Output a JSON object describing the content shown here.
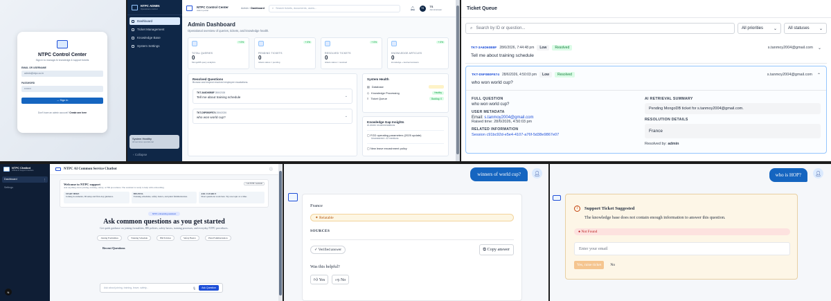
{
  "login": {
    "title": "NTPC Control Center",
    "subtitle": "Sign in to manage AI knowledge & support tickets",
    "email_label": "EMAIL OR USERNAME",
    "email_value": "admin@ntpc.co.in",
    "password_label": "PASSWORD",
    "password_value": "••••••••",
    "signin_label": "Sign In",
    "footer_text": "Don't have an admin account?",
    "footer_link": "Create one here"
  },
  "admin": {
    "brand_title": "NTPC ADMIN",
    "brand_sub": "Operations control",
    "nav": [
      {
        "label": "Dashboard"
      },
      {
        "label": "Ticket Management"
      },
      {
        "label": "Knowledge Base"
      },
      {
        "label": "System Settings"
      }
    ],
    "health_title": "System Healthy",
    "health_sub": "All services operational",
    "collapse_label": "Collapse",
    "app_title": "NTPC Control Center",
    "app_sub": "Admin portal",
    "crumb_root": "Admin",
    "crumb_page": "Dashboard",
    "search_placeholder": "Search tickets, documents, users...",
    "user_initials": "TS",
    "user_name": "TS",
    "user_role": "Administrator",
    "page_title": "Admin Dashboard",
    "page_sub": "Operational overview of queries, tickets, and knowledge health.",
    "stats": [
      {
        "label": "TOTAL QUERIES",
        "value": "0",
        "desc": "MongoDB query analytics",
        "pct": "+ 0%"
      },
      {
        "label": "PENDING TICKETS",
        "value": "0",
        "desc": "tickets status = pending",
        "pct": "+ 0%"
      },
      {
        "label": "RESOLVED TICKETS",
        "value": "0",
        "desc": "tickets status = resolved",
        "pct": "+ 0%"
      },
      {
        "label": "KNOWLEDGE ARTICLES",
        "value": "0",
        "desc": "knowledge + learned answers",
        "pct": "+ 0%"
      }
    ],
    "resolved_title": "Resolved Questions",
    "resolved_sub": "Browse and inspect resolved employee escalations.",
    "resolved_items": [
      {
        "id": "TKT-3A6D60B8F",
        "date": "28/6/2026",
        "question": "Tell me about training schedule"
      },
      {
        "id": "TKT-D5F0B0FE74",
        "date": "28/6/2026",
        "question": "who won world cup?"
      }
    ],
    "health_card_title": "System Health",
    "health_rows": [
      {
        "label": "Database",
        "badge": "",
        "color": "#f59e0b",
        "bg": "#fef3c7"
      },
      {
        "label": "Knowledge Processing",
        "badge": "Healthy",
        "color": "#16a34a",
        "bg": "#dcfce7"
      },
      {
        "label": "Ticket Queue",
        "badge": "Backlog: 0",
        "color": "#16a34a",
        "bg": "#dcfce7"
      }
    ],
    "gap_title": "Knowledge Gap Insights",
    "gap_sub": "AI-driven recommendations",
    "gap_items": [
      {
        "title": "FGD operating parameters (2025 update)",
        "sub": "Unanswered • 42 mentions"
      },
      {
        "title": "New leave encashment policy",
        "sub": ""
      }
    ]
  },
  "queue": {
    "title": "Ticket Queue",
    "search_placeholder": "Search by ID or question...",
    "priority_label": "All priorities",
    "status_label": "All statuses",
    "tickets": [
      {
        "id": "TKT-3A6D60B8F",
        "datetime": "28/6/2026, 7:44:48 pm",
        "priority": "Low",
        "status": "Resolved",
        "email": "s.tanmoy2004@gmail.com",
        "question": "Tell me about training schedule"
      },
      {
        "id": "TKT-D5F0B0FE74",
        "datetime": "28/6/2026, 4:50:03 pm",
        "priority": "Low",
        "status": "Resolved",
        "email": "s.tanmoy2004@gmail.com",
        "question": "who won world cup?"
      }
    ],
    "detail": {
      "full_question_label": "FULL QUESTION",
      "full_question": "who won world cup?",
      "metadata_label": "USER METADATA",
      "email_prefix": "Email:",
      "email": "s.tanmoy2004@gmail.com",
      "raised": "Raised time: 28/6/2026, 4:50:03 pm",
      "related_label": "RELATED INFORMATION",
      "session": "Session c91bc92d-e5e4-4107-a76f-5d38e9867e07",
      "ai_label": "AI RETRIEVAL SUMMARY",
      "ai_summary": "Pending MongoDB ticket for s.tanmoy2004@gmail.com.",
      "resolution_label": "RESOLUTION DETAILS",
      "resolution": "France",
      "resolved_by_prefix": "Resolved by:",
      "resolved_by": "admin"
    }
  },
  "chatbot": {
    "brand": "NTPC Chatbot",
    "brand_sub": "Official AI Support Interface",
    "nav_dashboard": "Dashboard",
    "nav_settings": "Settings",
    "user_badge": "N",
    "top_title": "NTPC AI Common Service Chatbot",
    "welcome_title": "Welcome to NTPC support",
    "welcome_sub": "Ask anything about joining, training, safety, or HR procedures. The assistant is ready to help with onboarding.",
    "welcome_tag": "I am NTPC Assistant",
    "cols": [
      {
        "title": "START HERE",
        "desc": "Joining documents, ID setup and first-day guidance."
      },
      {
        "title": "HELPFUL",
        "desc": "Training schedules, safety basics, and plant familiarization."
      },
      {
        "title": "ASK CLEARLY",
        "desc": "Short questions work best. Try one topic at a time."
      }
    ],
    "pill": "NTPC onboarding assistant",
    "ask_title": "Ask common questions as you get started",
    "ask_desc": "Get quick guidance on joining formalities, HR policies, safety basics, training processes, and everyday NTPC procedures.",
    "chips": [
      "Joining Formalities",
      "Training Schedule",
      "HR Policies",
      "Safety Basics",
      "Plant Familiarization"
    ],
    "recent_label": "Recent Questions",
    "input_placeholder": "Ask about joining, training, leave, safety...",
    "ask_button": "Ask Question"
  },
  "answer": {
    "user_message": "winners of world cup?",
    "answer_text": "France",
    "relatable": "Relatable",
    "sources_label": "SOURCES",
    "verified": "Verified answer",
    "copy": "Copy answer",
    "helpful": "Was this helpful?",
    "yes": "Yes",
    "no": "No"
  },
  "support": {
    "user_message": "who is HOP?",
    "title": "Support Ticket Suggested",
    "message": "The knowledge base does not contain enough information to answer this question.",
    "not_found": "Not Found",
    "email_placeholder": "Enter your email",
    "raise": "Yes, raise ticket",
    "no": "No"
  }
}
